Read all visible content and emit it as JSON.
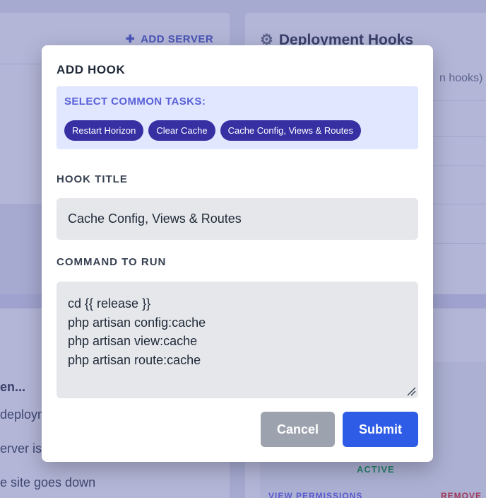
{
  "background": {
    "add_server_label": "ADD SERVER",
    "deployment_hooks_title": "Deployment Hooks",
    "hooks_subtext": "n hooks)",
    "bottom_left_heading": "en...",
    "bottom_left_items": [
      "deploym",
      "erver is",
      "e site goes down"
    ],
    "active_label": "ACTIVE",
    "view_permissions_label": "VIEW PERMISSIONS",
    "remove_label": "REMOVE"
  },
  "modal": {
    "title": "ADD HOOK",
    "common_tasks": {
      "label": "SELECT COMMON TASKS:",
      "chips": [
        "Restart Horizon",
        "Clear Cache",
        "Cache Config, Views & Routes"
      ]
    },
    "hook_title": {
      "label": "HOOK TITLE",
      "value": "Cache Config, Views & Routes"
    },
    "command": {
      "label": "COMMAND TO RUN",
      "lines": [
        "cd {{ release }}",
        "php artisan config:cache",
        "php artisan view:cache",
        "php artisan route:cache"
      ]
    },
    "buttons": {
      "cancel": "Cancel",
      "submit": "Submit"
    }
  },
  "colors": {
    "chip": "#3730a3",
    "tasks_bg": "#e0e7ff",
    "submit": "#2e5ce6",
    "cancel": "#9ca3af",
    "active": "#16a34a",
    "remove": "#dc2626"
  },
  "icons": {
    "add_server": "plus-icon",
    "deployment_hooks": "gear-icon",
    "textarea_resize": "resize-handle-icon"
  }
}
